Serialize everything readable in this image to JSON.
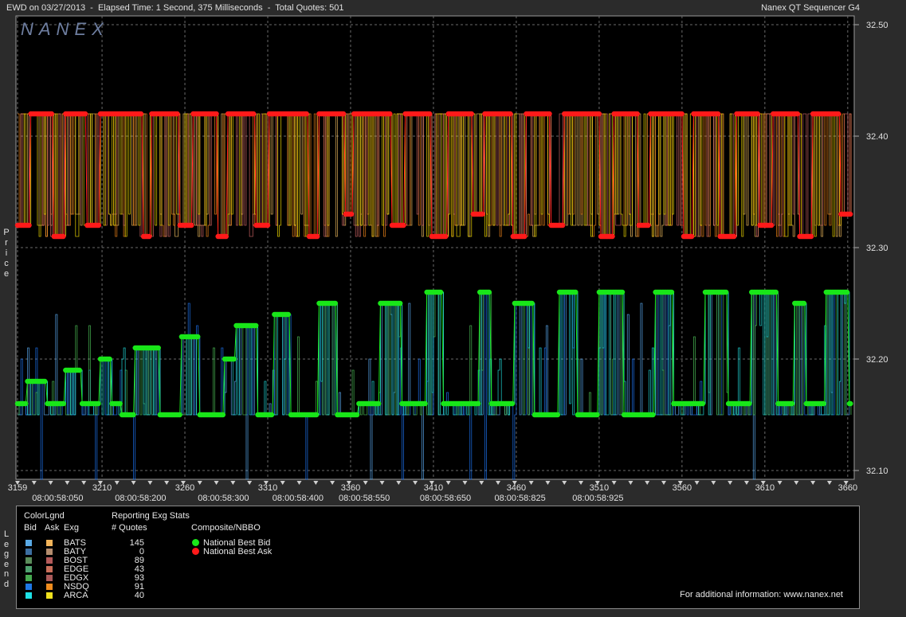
{
  "window": {
    "title_left": "EWD on 03/27/2013  -  Elapsed Time: 1 Second, 375 Milliseconds  -  Total Quotes: 501",
    "title_right": "Nanex QT Sequencer G4"
  },
  "logo": "NANEX",
  "axis_side_label": "Price",
  "legend_side_label": "Legend",
  "chart_data": {
    "type": "line",
    "title": "",
    "ylabel": "Price",
    "ylim": [
      32.095,
      32.5
    ],
    "yticks": [
      "32.50",
      "32.40",
      "32.30",
      "32.20",
      "32.10"
    ],
    "ytick_values": [
      32.5,
      32.4,
      32.3,
      32.2,
      32.1
    ],
    "xlim": [
      3159,
      3662
    ],
    "xticks": [
      3159,
      3210,
      3260,
      3310,
      3360,
      3410,
      3460,
      3510,
      3560,
      3610,
      3660
    ],
    "xtick_labels": [
      "3159",
      "3210",
      "3260",
      "3310",
      "3360",
      "3410",
      "3460",
      "3510",
      "3560",
      "3610",
      "3660"
    ],
    "time_labels": [
      {
        "x": 3164,
        "label": "08:00:58:050"
      },
      {
        "x": 3214,
        "label": "08:00:58:200"
      },
      {
        "x": 3264,
        "label": "08:00:58:300"
      },
      {
        "x": 3309,
        "label": "08:00:58:400"
      },
      {
        "x": 3349,
        "label": "08:00:58:550"
      },
      {
        "x": 3398,
        "label": "08:00:58:650"
      },
      {
        "x": 3443,
        "label": "08:00:58:825"
      },
      {
        "x": 3490,
        "label": "08:00:58:925"
      }
    ],
    "grid": true,
    "ask_levels": {
      "high": 32.42,
      "low": 32.31,
      "mid": 32.32,
      "mid2": 32.33
    },
    "bid_levels": [
      32.15,
      32.16,
      32.18,
      32.19,
      32.2,
      32.21,
      32.22,
      32.23,
      32.24,
      32.25,
      32.26
    ],
    "series": [
      {
        "name": "National Best Ask",
        "color": "#ff1a1a",
        "points": [
          [
            3159,
            32.32
          ],
          [
            3166,
            32.32
          ],
          [
            3167,
            32.42
          ],
          [
            3180,
            32.42
          ],
          [
            3181,
            32.31
          ],
          [
            3187,
            32.31
          ],
          [
            3188,
            32.42
          ],
          [
            3200,
            32.42
          ],
          [
            3201,
            32.32
          ],
          [
            3208,
            32.32
          ],
          [
            3209,
            32.42
          ],
          [
            3234,
            32.42
          ],
          [
            3235,
            32.31
          ],
          [
            3239,
            32.31
          ],
          [
            3240,
            32.42
          ],
          [
            3256,
            32.42
          ],
          [
            3257,
            32.32
          ],
          [
            3264,
            32.32
          ],
          [
            3265,
            32.42
          ],
          [
            3279,
            32.42
          ],
          [
            3280,
            32.31
          ],
          [
            3285,
            32.31
          ],
          [
            3286,
            32.42
          ],
          [
            3302,
            32.42
          ],
          [
            3303,
            32.32
          ],
          [
            3310,
            32.32
          ],
          [
            3311,
            32.42
          ],
          [
            3334,
            32.42
          ],
          [
            3335,
            32.31
          ],
          [
            3340,
            32.31
          ],
          [
            3341,
            32.42
          ],
          [
            3356,
            32.42
          ],
          [
            3357,
            32.33
          ],
          [
            3361,
            32.33
          ],
          [
            3362,
            32.42
          ],
          [
            3384,
            32.42
          ],
          [
            3385,
            32.32
          ],
          [
            3392,
            32.32
          ],
          [
            3393,
            32.42
          ],
          [
            3408,
            32.42
          ],
          [
            3409,
            32.31
          ],
          [
            3418,
            32.31
          ],
          [
            3419,
            32.42
          ],
          [
            3433,
            32.42
          ],
          [
            3434,
            32.33
          ],
          [
            3440,
            32.33
          ],
          [
            3441,
            32.42
          ],
          [
            3457,
            32.42
          ],
          [
            3458,
            32.31
          ],
          [
            3465,
            32.31
          ],
          [
            3466,
            32.42
          ],
          [
            3480,
            32.42
          ],
          [
            3481,
            32.32
          ],
          [
            3488,
            32.32
          ],
          [
            3489,
            32.42
          ],
          [
            3510,
            32.42
          ],
          [
            3511,
            32.31
          ],
          [
            3518,
            32.31
          ],
          [
            3519,
            32.42
          ],
          [
            3533,
            32.42
          ],
          [
            3534,
            32.32
          ],
          [
            3540,
            32.32
          ],
          [
            3541,
            32.42
          ],
          [
            3560,
            32.42
          ],
          [
            3561,
            32.31
          ],
          [
            3566,
            32.31
          ],
          [
            3567,
            32.42
          ],
          [
            3582,
            32.42
          ],
          [
            3583,
            32.31
          ],
          [
            3592,
            32.31
          ],
          [
            3593,
            32.42
          ],
          [
            3606,
            32.42
          ],
          [
            3607,
            32.32
          ],
          [
            3614,
            32.32
          ],
          [
            3615,
            32.42
          ],
          [
            3630,
            32.42
          ],
          [
            3631,
            32.31
          ],
          [
            3638,
            32.31
          ],
          [
            3639,
            32.42
          ],
          [
            3655,
            32.42
          ],
          [
            3656,
            32.33
          ],
          [
            3662,
            32.33
          ]
        ]
      },
      {
        "name": "National Best Bid",
        "color": "#19e619",
        "points": [
          [
            3159,
            32.16
          ],
          [
            3164,
            32.16
          ],
          [
            3165,
            32.18
          ],
          [
            3176,
            32.18
          ],
          [
            3177,
            32.16
          ],
          [
            3187,
            32.16
          ],
          [
            3188,
            32.19
          ],
          [
            3197,
            32.19
          ],
          [
            3198,
            32.16
          ],
          [
            3208,
            32.16
          ],
          [
            3209,
            32.2
          ],
          [
            3215,
            32.2
          ],
          [
            3216,
            32.16
          ],
          [
            3221,
            32.16
          ],
          [
            3222,
            32.15
          ],
          [
            3229,
            32.15
          ],
          [
            3230,
            32.21
          ],
          [
            3244,
            32.21
          ],
          [
            3245,
            32.15
          ],
          [
            3257,
            32.15
          ],
          [
            3258,
            32.22
          ],
          [
            3268,
            32.22
          ],
          [
            3269,
            32.15
          ],
          [
            3283,
            32.15
          ],
          [
            3284,
            32.2
          ],
          [
            3290,
            32.2
          ],
          [
            3291,
            32.23
          ],
          [
            3303,
            32.23
          ],
          [
            3304,
            32.15
          ],
          [
            3313,
            32.15
          ],
          [
            3314,
            32.24
          ],
          [
            3323,
            32.24
          ],
          [
            3324,
            32.15
          ],
          [
            3340,
            32.15
          ],
          [
            3341,
            32.25
          ],
          [
            3351,
            32.25
          ],
          [
            3352,
            32.15
          ],
          [
            3364,
            32.15
          ],
          [
            3365,
            32.16
          ],
          [
            3377,
            32.16
          ],
          [
            3378,
            32.25
          ],
          [
            3390,
            32.25
          ],
          [
            3391,
            32.16
          ],
          [
            3405,
            32.16
          ],
          [
            3406,
            32.26
          ],
          [
            3415,
            32.26
          ],
          [
            3416,
            32.16
          ],
          [
            3437,
            32.16
          ],
          [
            3438,
            32.26
          ],
          [
            3444,
            32.26
          ],
          [
            3445,
            32.16
          ],
          [
            3458,
            32.16
          ],
          [
            3459,
            32.25
          ],
          [
            3470,
            32.25
          ],
          [
            3471,
            32.15
          ],
          [
            3485,
            32.15
          ],
          [
            3486,
            32.26
          ],
          [
            3496,
            32.26
          ],
          [
            3497,
            32.15
          ],
          [
            3509,
            32.15
          ],
          [
            3510,
            32.26
          ],
          [
            3524,
            32.26
          ],
          [
            3525,
            32.15
          ],
          [
            3543,
            32.15
          ],
          [
            3544,
            32.26
          ],
          [
            3554,
            32.26
          ],
          [
            3555,
            32.16
          ],
          [
            3573,
            32.16
          ],
          [
            3574,
            32.26
          ],
          [
            3587,
            32.26
          ],
          [
            3588,
            32.16
          ],
          [
            3601,
            32.16
          ],
          [
            3602,
            32.26
          ],
          [
            3617,
            32.26
          ],
          [
            3618,
            32.16
          ],
          [
            3627,
            32.16
          ],
          [
            3628,
            32.25
          ],
          [
            3634,
            32.25
          ],
          [
            3635,
            32.16
          ],
          [
            3646,
            32.16
          ],
          [
            3647,
            32.26
          ],
          [
            3660,
            32.26
          ],
          [
            3661,
            32.16
          ],
          [
            3662,
            32.16
          ]
        ]
      }
    ],
    "exchange_lines": [
      {
        "name": "BATS",
        "bid_color": "#5fb4ff",
        "ask_color": "#ffc864"
      },
      {
        "name": "NSDQ",
        "bid_color": "#1e7bff",
        "ask_color": "#ff8c1a"
      },
      {
        "name": "EDGX",
        "bid_color": "#4fc85a",
        "ask_color": "#d86a6a"
      },
      {
        "name": "ARCA",
        "bid_color": "#22e6e6",
        "ask_color": "#ffe600"
      }
    ]
  },
  "legend": {
    "color_legend_title": "ColorLgnd",
    "stats_title": "Reporting Exg Stats",
    "col_bid": "Bid",
    "col_ask": "Ask",
    "col_exg": "Exg",
    "col_quotes": "# Quotes",
    "composite_title": "Composite/NBBO",
    "exchanges": [
      {
        "name": "BATS",
        "quotes": "145",
        "bid_color": "#5aaae6",
        "ask_color": "#f2b45a"
      },
      {
        "name": "BATY",
        "quotes": "0",
        "bid_color": "#3c6ea0",
        "ask_color": "#b48c6e"
      },
      {
        "name": "BOST",
        "quotes": "89",
        "bid_color": "#5a8c5a",
        "ask_color": "#b45a5a"
      },
      {
        "name": "EDGE",
        "quotes": "43",
        "bid_color": "#4ea06e",
        "ask_color": "#c86e5a"
      },
      {
        "name": "EDGX",
        "quotes": "93",
        "bid_color": "#46aa50",
        "ask_color": "#aa5a5a"
      },
      {
        "name": "NSDQ",
        "quotes": "91",
        "bid_color": "#1e78e6",
        "ask_color": "#f08c1e"
      },
      {
        "name": "ARCA",
        "quotes": "40",
        "bid_color": "#1ee1e6",
        "ask_color": "#f0e11e"
      }
    ],
    "composite": [
      {
        "name": "National Best Bid",
        "color": "#19e619"
      },
      {
        "name": "National Best Ask",
        "color": "#ff1a1a"
      }
    ],
    "footer": "For additional information: www.nanex.net"
  }
}
